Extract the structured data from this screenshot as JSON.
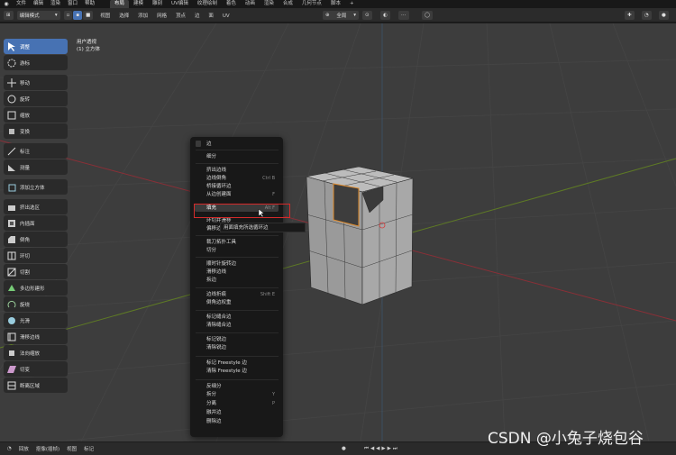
{
  "topbar": {
    "menus": [
      "文件",
      "编辑",
      "渲染",
      "窗口",
      "帮助"
    ],
    "tabs": [
      "布局",
      "建模",
      "雕刻",
      "UV编辑",
      "纹理绘制",
      "着色",
      "动画",
      "渲染",
      "合成",
      "几何节点",
      "脚本",
      "+"
    ],
    "active_tab": "布局"
  },
  "header": {
    "mode": "编辑模式",
    "menus": [
      "视图",
      "选择",
      "添加",
      "网格",
      "顶点",
      "边",
      "面",
      "UV"
    ],
    "transform": "全局"
  },
  "view_info": {
    "line1": "用户透视",
    "line2": "(1) 立方体"
  },
  "toolbar": {
    "tools": [
      "调整",
      "游标",
      "移动",
      "旋转",
      "缩放",
      "变换",
      "标注",
      "测量",
      "添加立方体",
      "挤出选区",
      "内插面",
      "倒角",
      "环切",
      "切割",
      "多边形建形",
      "旋绕",
      "光滑",
      "滑移边线",
      "法向缩放",
      "切变",
      "断离区域"
    ]
  },
  "context_menu": {
    "title": "边",
    "items": [
      {
        "label": "细分",
        "shortcut": ""
      },
      {
        "label": "挤出边线",
        "shortcut": ""
      },
      {
        "label": "边线倒角",
        "shortcut": "Ctrl B"
      },
      {
        "label": "桥接循环边",
        "shortcut": ""
      },
      {
        "label": "从边创建面",
        "shortcut": "F"
      },
      {
        "label": "填充",
        "shortcut": "Alt F"
      },
      {
        "label": "环切并滑移",
        "shortcut": ""
      },
      {
        "label": "偏移边线并滑移",
        "shortcut": ""
      },
      {
        "label": "裁刀拓扑工具",
        "shortcut": ""
      },
      {
        "label": "切分",
        "shortcut": ""
      },
      {
        "label": "顺时针旋转边",
        "shortcut": ""
      },
      {
        "label": "滑移边线",
        "shortcut": ""
      },
      {
        "label": "拆边",
        "shortcut": ""
      },
      {
        "label": "边线折痕",
        "shortcut": "Shift E"
      },
      {
        "label": "倒角边权重",
        "shortcut": ""
      },
      {
        "label": "标记缝合边",
        "shortcut": ""
      },
      {
        "label": "清除缝合边",
        "shortcut": ""
      },
      {
        "label": "标记锐边",
        "shortcut": ""
      },
      {
        "label": "清除锐边",
        "shortcut": ""
      },
      {
        "label": "标记 Freestyle 边",
        "shortcut": ""
      },
      {
        "label": "清除 Freestyle 边",
        "shortcut": ""
      },
      {
        "label": "反细分",
        "shortcut": ""
      },
      {
        "label": "拆分",
        "shortcut": "Y"
      },
      {
        "label": "分离",
        "shortcut": "P"
      },
      {
        "label": "融并边",
        "shortcut": ""
      },
      {
        "label": "删除边",
        "shortcut": ""
      }
    ],
    "tooltip": "用面填充所选循环边"
  },
  "bottombar": {
    "items": [
      "回放",
      "抠像(插帧)",
      "视图",
      "标记"
    ]
  },
  "watermark": "CSDN @小兔子烧包谷",
  "colors": {
    "accent": "#4772b3",
    "highlight_box": "#d42a2a",
    "viewport_bg": "#3d3d3d",
    "x_axis": "#a0303a",
    "y_axis": "#6a8a2a"
  }
}
